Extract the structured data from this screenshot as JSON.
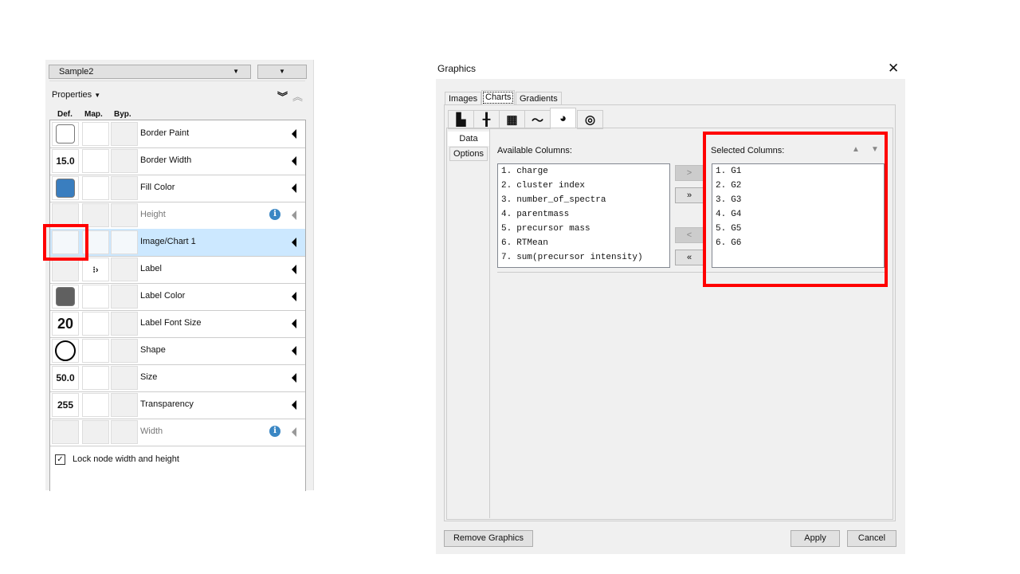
{
  "left_panel": {
    "network_select": "Sample2",
    "properties_label": "Properties",
    "headers": [
      "Def.",
      "Map.",
      "Byp."
    ],
    "rows": [
      {
        "label": "Border Paint",
        "def": "",
        "def_type": "color",
        "def_color": "#ffffff",
        "enabled": true
      },
      {
        "label": "Border Width",
        "def": "15.0",
        "def_type": "text",
        "enabled": true
      },
      {
        "label": "Fill Color",
        "def": "",
        "def_type": "color",
        "def_color": "#3a7ebf",
        "enabled": true
      },
      {
        "label": "Height",
        "def": "",
        "def_type": "none",
        "enabled": false,
        "info": true
      },
      {
        "label": "Image/Chart 1",
        "def": "",
        "def_type": "none",
        "enabled": true,
        "selected": true
      },
      {
        "label": "Label",
        "def": "",
        "def_type": "none",
        "enabled": true,
        "mapping": "passthrough-icon"
      },
      {
        "label": "Label Color",
        "def": "",
        "def_type": "color",
        "def_color": "#606060",
        "enabled": true
      },
      {
        "label": "Label Font Size",
        "def": "20",
        "def_type": "bigtext",
        "enabled": true
      },
      {
        "label": "Shape",
        "def": "",
        "def_type": "circle",
        "enabled": true
      },
      {
        "label": "Size",
        "def": "50.0",
        "def_type": "text",
        "enabled": true
      },
      {
        "label": "Transparency",
        "def": "255",
        "def_type": "text",
        "enabled": true
      },
      {
        "label": "Width",
        "def": "",
        "def_type": "none",
        "enabled": false,
        "info": true
      }
    ],
    "lock_label": "Lock node width and height",
    "lock_checked": true
  },
  "dialog": {
    "title": "Graphics",
    "tabs": [
      "Images",
      "Charts",
      "Gradients"
    ],
    "active_tab": "Charts",
    "chart_types": [
      "bar-chart-icon",
      "box-chart-icon",
      "heatmap-chart-icon",
      "line-chart-icon",
      "pie-chart-icon",
      "ring-chart-icon"
    ],
    "active_chart_type": "pie-chart-icon",
    "side_tabs": [
      "Data",
      "Options"
    ],
    "available_label": "Available Columns:",
    "available": [
      "charge",
      "cluster index",
      "number_of_spectra",
      "parentmass",
      "precursor mass",
      "RTMean",
      "sum(precursor intensity)"
    ],
    "selected_label": "Selected Columns:",
    "selected": [
      "G1",
      "G2",
      "G3",
      "G4",
      "G5",
      "G6"
    ],
    "move_buttons": [
      ">",
      "»",
      "<",
      "«"
    ],
    "remove_label": "Remove Graphics",
    "apply_label": "Apply",
    "cancel_label": "Cancel"
  },
  "highlight_color": "#ff0000"
}
